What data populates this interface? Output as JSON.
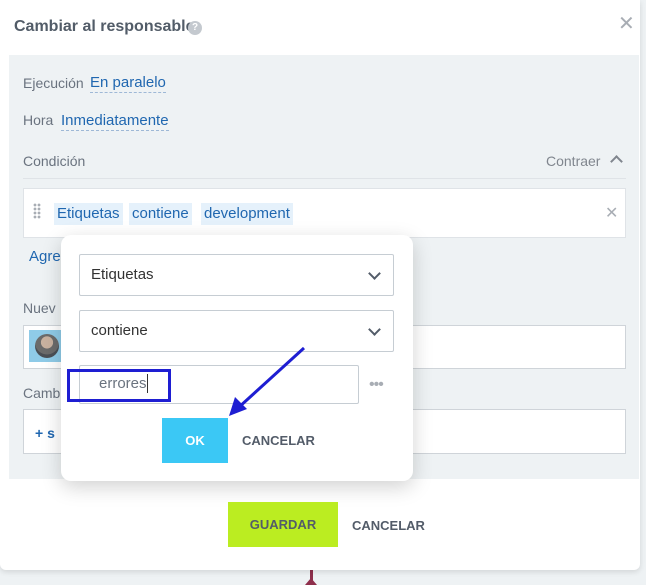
{
  "dialog": {
    "title": "Cambiar al responsable",
    "close_symbol": "✕",
    "help_symbol": "?"
  },
  "settings": {
    "execution_label": "Ejecución",
    "execution_value": "En paralelo",
    "time_label": "Hora",
    "time_value": "Inmediatamente",
    "condition_label": "Condición",
    "collapse_label": "Contraer"
  },
  "condition": {
    "chips": [
      "Etiquetas",
      "contiene",
      "development"
    ],
    "clear_symbol": "✕"
  },
  "partial": {
    "add_link": "Agre",
    "new_label": "Nuev",
    "change_label": "Camb",
    "add_plus": "+ s"
  },
  "popup": {
    "field_select": "Etiquetas",
    "operator_select": "contiene",
    "value_input": "errores",
    "more_symbol": "•••",
    "ok_label": "OK",
    "cancel_label": "CANCELAR"
  },
  "footer": {
    "save_label": "GUARDAR",
    "cancel_label": "CANCELAR"
  },
  "colors": {
    "link": "#2067b0",
    "ok_button": "#3bc8f5",
    "save_button": "#bbed21",
    "annotation": "#1e1ed2"
  },
  "icons": [
    "help-icon",
    "close-icon",
    "chevron-up-icon",
    "drag-handle-icon",
    "clear-icon",
    "chevron-down-icon",
    "more-icon",
    "avatar"
  ]
}
